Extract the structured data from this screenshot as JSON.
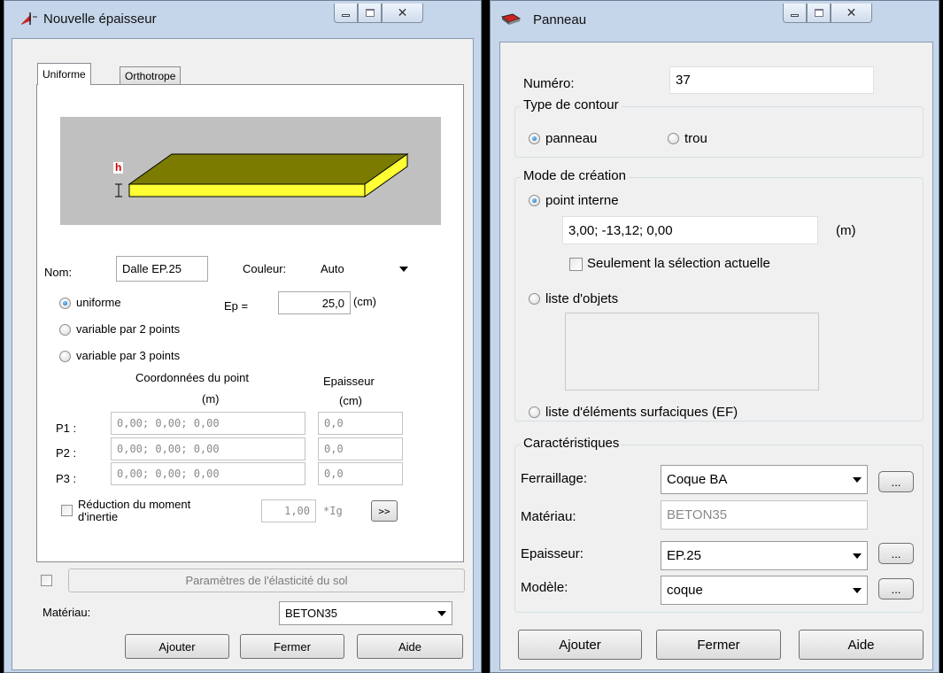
{
  "window1": {
    "title": "Nouvelle épaisseur",
    "tabs": [
      "Uniforme",
      "Orthotrope"
    ],
    "diagram": {
      "h_label": "h",
      "colors": {
        "top": "#7b7b00",
        "side": "#ffff33",
        "background": "#c0c0c0",
        "h_label": "#cc0000"
      }
    },
    "nom_label": "Nom:",
    "nom_value": "Dalle EP.25",
    "couleur_label": "Couleur:",
    "couleur_value": "Auto",
    "radio_uniforme": "uniforme",
    "ep_label": "Ep =",
    "ep_value": "25,0",
    "ep_unit": "(cm)",
    "radio_var2": "variable par 2 points",
    "radio_var3": "variable par 3 points",
    "coord_header": "Coordonnées du point",
    "coord_unit": "(m)",
    "ep_header": "Epaisseur",
    "ep_header_unit": "(cm)",
    "points": [
      {
        "label": "P1 :",
        "coords": "0,00; 0,00; 0,00",
        "ep": "0,0"
      },
      {
        "label": "P2 :",
        "coords": "0,00; 0,00; 0,00",
        "ep": "0,0"
      },
      {
        "label": "P3 :",
        "coords": "0,00; 0,00; 0,00",
        "ep": "0,0"
      }
    ],
    "reduction_line1": "Réduction du moment",
    "reduction_line2": "d'inertie",
    "reduction_value": "1,00",
    "reduction_unit": "*Ig",
    "expand_button": ">>",
    "sol_button": "Paramètres de l'élasticité du sol",
    "materiau_label": "Matériau:",
    "materiau_value": "BETON35",
    "buttons": {
      "ajouter": "Ajouter",
      "fermer": "Fermer",
      "aide": "Aide"
    }
  },
  "window2": {
    "title": "Panneau",
    "numero_label": "Numéro:",
    "numero_value": "37",
    "type_contour": {
      "title": "Type de contour",
      "panneau": "panneau",
      "trou": "trou"
    },
    "mode_creation": {
      "title": "Mode de création",
      "point_interne": "point interne",
      "point_value": "3,00; -13,12; 0,00",
      "point_unit": "(m)",
      "seulement": "Seulement la sélection actuelle",
      "liste_objets": "liste d'objets",
      "liste_elements": "liste d'éléments surfaciques (EF)"
    },
    "caracteristiques": {
      "title": "Caractéristiques",
      "ferraillage_label": "Ferraillage:",
      "ferraillage_value": "Coque BA",
      "materiau_label": "Matériau:",
      "materiau_value": "BETON35",
      "epaisseur_label": "Epaisseur:",
      "epaisseur_value": "EP.25",
      "modele_label": "Modèle:",
      "modele_value": "coque",
      "more": "..."
    },
    "buttons": {
      "ajouter": "Ajouter",
      "fermer": "Fermer",
      "aide": "Aide"
    }
  }
}
